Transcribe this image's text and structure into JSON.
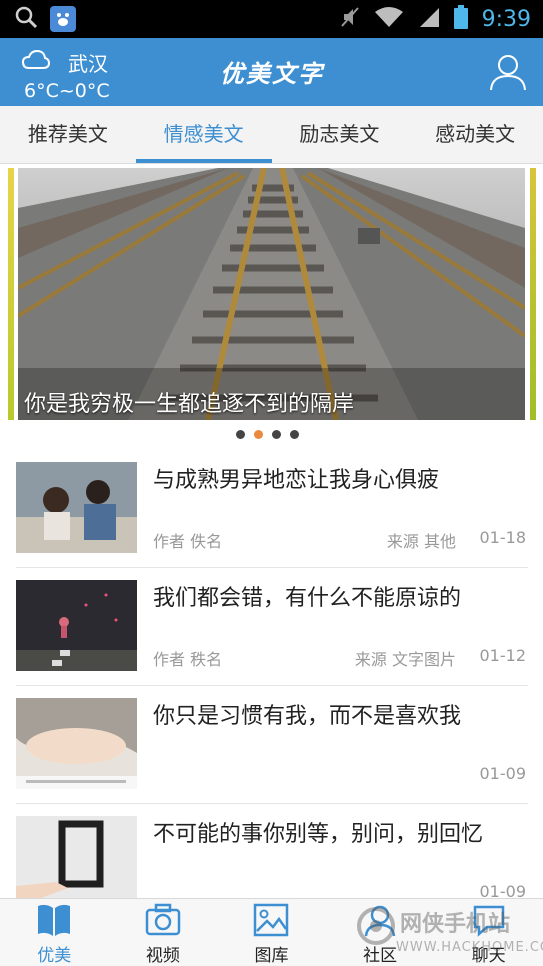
{
  "status_bar": {
    "time": "9:39",
    "icons": [
      "search-icon",
      "baidu-app-icon",
      "mute-icon",
      "wifi-icon",
      "signal-icon",
      "battery-icon"
    ]
  },
  "header": {
    "city": "武汉",
    "temperature": "6°C~0°C",
    "logo_text": "优美文字",
    "accent_color": "#3d8fd2"
  },
  "tabs": [
    {
      "label": "推荐美文",
      "active": false
    },
    {
      "label": "情感美文",
      "active": true
    },
    {
      "label": "励志美文",
      "active": false
    },
    {
      "label": "感动美文",
      "active": false
    }
  ],
  "banner": {
    "caption": "你是我穷极一生都追逐不到的隔岸",
    "page_count": 4,
    "active_page": 1
  },
  "articles": [
    {
      "title": "与成熟男异地恋让我身心俱疲",
      "author": "作者 佚名",
      "source": "来源 其他",
      "date": "01-18"
    },
    {
      "title": "我们都会错，有什么不能原谅的",
      "author": "作者 秩名",
      "source": "来源 文字图片",
      "date": "01-12"
    },
    {
      "title": "你只是习惯有我，而不是喜欢我",
      "author": "",
      "source": "",
      "date": "01-09"
    },
    {
      "title": "不可能的事你别等，别问，别回忆",
      "author": "",
      "source": "",
      "date": "01-09"
    }
  ],
  "bottom_nav": [
    {
      "label": "优美",
      "icon": "book-icon",
      "active": true
    },
    {
      "label": "视频",
      "icon": "camera-icon",
      "active": false
    },
    {
      "label": "图库",
      "icon": "picture-icon",
      "active": false
    },
    {
      "label": "社区",
      "icon": "community-icon",
      "active": false
    },
    {
      "label": "聊天",
      "icon": "chat-icon",
      "active": false
    }
  ],
  "watermark": {
    "title": "网侠手机站",
    "url": "WWW.HACKHOME.COM"
  }
}
